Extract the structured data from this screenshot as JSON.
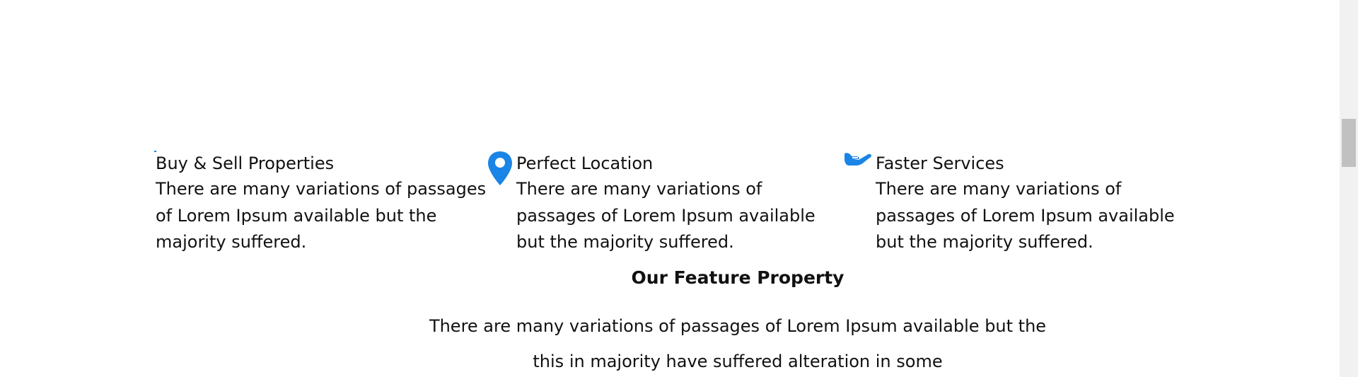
{
  "features": [
    {
      "title": "Buy & Sell Properties",
      "text": "There are many variations of passages of Lorem Ipsum available but the majority suffered.",
      "icon": "tiny-image-icon",
      "icon_color": "#1a85e6"
    },
    {
      "title": "Perfect Location",
      "text": "There are many variations of passages of Lorem Ipsum available but the majority suffered.",
      "icon": "map-pin-icon",
      "icon_color": "#1a85e6"
    },
    {
      "title": "Faster Services",
      "text": "There are many variations of passages of Lorem Ipsum available but the majority suffered.",
      "icon": "hand-holding-icon",
      "icon_color": "#1a85e6"
    }
  ],
  "section": {
    "heading": "Our Feature Property",
    "subtext": "There are many variations of passages of Lorem Ipsum available but the this in majority have suffered alteration in some"
  }
}
